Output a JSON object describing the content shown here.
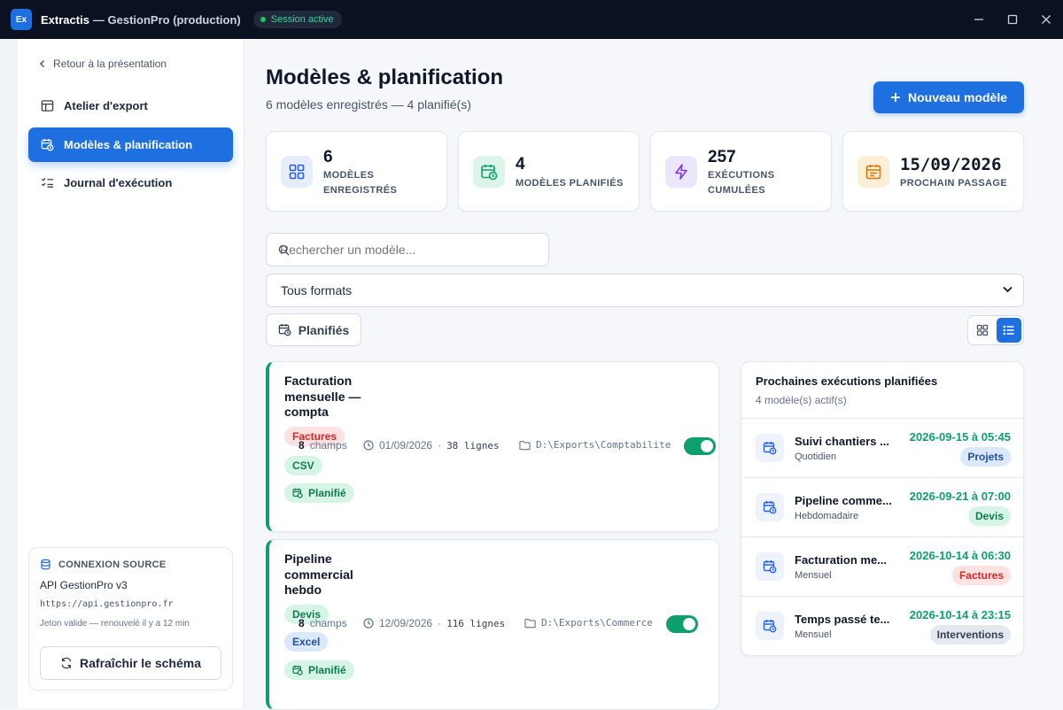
{
  "titlebar": {
    "app_name": "Extractis",
    "subtitle": "— GestionPro (production)",
    "logo_text": "Ex",
    "session_label": "Session active"
  },
  "sidebar": {
    "back_label": "Retour à la présentation",
    "items": [
      {
        "label": "Atelier d'export",
        "icon": "table-icon",
        "active": false
      },
      {
        "label": "Modèles & planification",
        "icon": "calendar-clock-icon",
        "active": true
      },
      {
        "label": "Journal d'exécution",
        "icon": "checklist-icon",
        "active": false
      }
    ],
    "connection": {
      "heading": "CONNEXION SOURCE",
      "name": "API GestionPro v3",
      "url": "https://api.gestionpro.fr",
      "token_status": "Jeton valide — renouvelé il y a 12 min",
      "refresh_label": "Rafraîchir le schéma"
    }
  },
  "header": {
    "title": "Modèles & planification",
    "subtitle": "6 modèles enregistrés — 4 planifié(s)",
    "new_button": "Nouveau modèle"
  },
  "stats": [
    {
      "value": "6",
      "label": "MODÈLES ENREGISTRÉS",
      "icon": "grid-icon",
      "color": "#2563eb"
    },
    {
      "value": "4",
      "label": "MODÈLES PLANIFIÉS",
      "icon": "calendar-clock-icon",
      "color": "#0e9f6e"
    },
    {
      "value": "257",
      "label": "EXÉCUTIONS CUMULÉES",
      "icon": "lightning-icon",
      "color": "#7c3aed"
    },
    {
      "value": "15/09/2026",
      "label": "PROCHAIN PASSAGE",
      "icon": "calendar-icon",
      "color": "#d97706"
    }
  ],
  "filters": {
    "search_placeholder": "Rechercher un modèle...",
    "format_selected": "Tous formats",
    "planned_label": "Planifiés",
    "view_mode": "list"
  },
  "templates": [
    {
      "name": "Facturation mensuelle — compta",
      "category": "Factures",
      "format": "CSV",
      "fields_count": "8",
      "fields_word": "champs",
      "date": "01/09/2026",
      "rows": "38 lignes",
      "path": "D:\\Exports\\Comptabilite",
      "planned_label": "Planifié",
      "enabled": true
    },
    {
      "name": "Pipeline commercial hebdo",
      "category": "Devis",
      "format": "Excel",
      "fields_count": "8",
      "fields_word": "champs",
      "date": "12/09/2026",
      "rows": "116 lignes",
      "path": "D:\\Exports\\Commerce",
      "planned_label": "Planifié",
      "enabled": true
    }
  ],
  "upcoming": {
    "title": "Prochaines exécutions planifiées",
    "subtitle": "4 modèle(s) actif(s)",
    "items": [
      {
        "name": "Suivi chantiers ...",
        "frequency": "Quotidien",
        "datetime": "2026-09-15 à 05:45",
        "category": "Projets"
      },
      {
        "name": "Pipeline comme...",
        "frequency": "Hebdomadaire",
        "datetime": "2026-09-21 à 07:00",
        "category": "Devis"
      },
      {
        "name": "Facturation me...",
        "frequency": "Mensuel",
        "datetime": "2026-10-14 à 06:30",
        "category": "Factures"
      },
      {
        "name": "Temps passé te...",
        "frequency": "Mensuel",
        "datetime": "2026-10-14 à 23:15",
        "category": "Interventions"
      }
    ]
  }
}
